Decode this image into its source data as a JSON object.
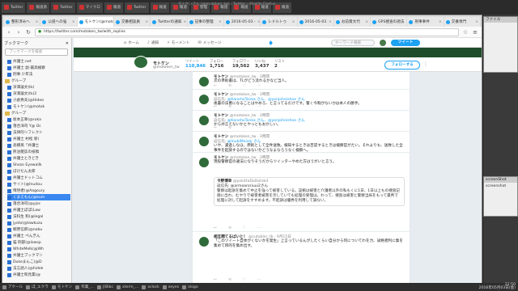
{
  "top_tabs": [
    "Twitter",
    "報道系",
    "Twitter",
    "マイクロ",
    "報道",
    "Twitter",
    "報道",
    "報道",
    "管理",
    "報道",
    "報道",
    "報道",
    "報道"
  ],
  "window_title": "モトケンさん (@motoken_tw) / Twitter – Mozilla Firefox",
  "browser_tabs": [
    {
      "label": "整形済みへ",
      "active": false
    },
    {
      "label": "公道への強",
      "active": false
    },
    {
      "label": "モトケン(@motoken",
      "active": true
    },
    {
      "label": "交番相談員",
      "active": false
    },
    {
      "label": "Twitterの通知",
      "active": false
    },
    {
      "label": "記事の整理",
      "active": false
    },
    {
      "label": "2016-05-03 -",
      "active": false
    },
    {
      "label": "レドルトゥ",
      "active": false
    },
    {
      "label": "2016-05-03",
      "active": false
    },
    {
      "label": "お前資文代",
      "active": false
    },
    {
      "label": "GPS捜査の適法",
      "active": false
    },
    {
      "label": "刑事事件",
      "active": false
    },
    {
      "label": "交番専門",
      "active": false
    }
  ],
  "url": "https://twitter.com/motoken_tw/with_replies",
  "sidebar": {
    "title": "ブックマーク",
    "search_placeholder": "ブックマークを検索",
    "items": [
      {
        "label": "弁護士.net",
        "type": "item"
      },
      {
        "label": "弁護士 副-最高検察",
        "type": "item"
      },
      {
        "label": "刑事 少年法",
        "type": "item"
      },
      {
        "label": "グループ",
        "type": "folder"
      },
      {
        "label": "深澤論文(tk)",
        "type": "item"
      },
      {
        "label": "深澤論文(tk)2",
        "type": "item"
      },
      {
        "label": "小倉秀夫(@Hideo",
        "type": "item"
      },
      {
        "label": "モトケン(@motok",
        "type": "item"
      },
      {
        "label": "グループ",
        "type": "folder"
      },
      {
        "label": "坂本正幸(@ruka",
        "type": "item"
      },
      {
        "label": "落合洋司 Y@ Oc",
        "type": "item"
      },
      {
        "label": "法律的リフレクト",
        "type": "item"
      },
      {
        "label": "弁護士 村松 新(",
        "type": "item"
      },
      {
        "label": "高橋英「弁護士",
        "type": "item"
      },
      {
        "label": "民泊雑誌の投稿",
        "type": "item"
      },
      {
        "label": "弁護士ときどき",
        "type": "item"
      },
      {
        "label": "Shozo Eyewallk",
        "type": "item"
      },
      {
        "label": "ぼけだん太郎",
        "type": "item"
      },
      {
        "label": "弁護士ドットコム",
        "type": "item"
      },
      {
        "label": "サイト(@Inudou",
        "type": "item"
      },
      {
        "label": "悔悟者(@Aagoury",
        "type": "item"
      },
      {
        "label": "くまえもん(@kum",
        "type": "item",
        "selected": true
      },
      {
        "label": "落合洋司(@yjoc",
        "type": "item"
      },
      {
        "label": "弁護士ぽぽ(Law",
        "type": "item"
      },
      {
        "label": "法科生 和(@legal",
        "type": "item"
      },
      {
        "label": "jyoto(@lawkuzu",
        "type": "item"
      },
      {
        "label": "郷原信郎(@nobu",
        "type": "item"
      },
      {
        "label": "弁護士 ぺんぎん",
        "type": "item"
      },
      {
        "label": "猫 刑部(@lawsp",
        "type": "item"
      },
      {
        "label": "WhiteMelk(@Wh",
        "type": "item"
      },
      {
        "label": "弁護士ブックマン",
        "type": "item"
      },
      {
        "label": "Dukeまんこ(@D",
        "type": "item"
      },
      {
        "label": "法言語人(@hidek",
        "type": "item"
      },
      {
        "label": "弁護士和見薫(@",
        "type": "item"
      }
    ]
  },
  "twitter": {
    "nav": [
      "ホーム",
      "通知",
      "モーメント",
      "メッセージ"
    ],
    "search_placeholder": "キーワード検索",
    "tweet_button": "ツイート",
    "profile_name": "モトケン",
    "profile_handle": "@motoken_tw",
    "stats": [
      {
        "label": "ツイート",
        "value": "110,846",
        "active": true
      },
      {
        "label": "フォロー",
        "value": "1,716"
      },
      {
        "label": "フォロワー",
        "value": "19,562"
      },
      {
        "label": "いいね",
        "value": "3,437"
      },
      {
        "label": "リスト",
        "value": "2"
      }
    ],
    "follow_button": "フォローする",
    "tweets": [
      {
        "name": "モトケン",
        "handle": "@motoken_tw · 3時間",
        "reply_to": "",
        "reply_names": "",
        "text": "次の準則書は、TLがどう流れるかなど当人。"
      },
      {
        "name": "モトケン",
        "handle": "@motoken_tw · 3時間",
        "reply_to": "返信先: ",
        "reply_names": "@KanehoTonka さん、@yonjoheishoe さん",
        "text": "後輩の法曹になることはやめろ、と言ってるだけです。警く今暇がないかは本人の勝手。"
      },
      {
        "name": "モトケン",
        "handle": "@motoken_tw · 3時間",
        "reply_to": "返信先: ",
        "reply_names": "@KanehoTonka さん、@yonjoheishoe さん",
        "text": "から弁言えないかとやっともおかしい。"
      },
      {
        "name": "モトケン",
        "handle": "@motoken_tw · 3時間",
        "reply_to": "返信先: ",
        "reply_names": "@InubiMaialy さん",
        "text": "いや、濾過しなほ、原則として全件送致。検知するときは否認するときは検察官がたい。それよりも、送致した全事件を起訴するのではないかどうなよなろうなく検察へ。"
      },
      {
        "name": "モトケン",
        "handle": "@motoken_tw · 3時間",
        "reply_to": "",
        "reply_names": "",
        "text": "現役警察官の違法になりそうだからツイッターやめた方はうがいと言う。",
        "quote_name": "卡野博幸",
        "quote_handle": "@yokittaDoDoInbd",
        "quote_reply": "返信先: @armoaroriuui2さん",
        "quote_text": "警察は起訴を集めて中止を強って被害している。証拠は被害と介護者以外の私もくに1日、1日以上もの捜査記録に出れ、むやりで被害者被害を示していても処理の受理は。わって、捜査は被害と警察当局をもって最判で処理に対して起訴をすすめます。不起訴は優秀を利用して調ない。"
      },
      {
        "name": "相互関てるばいと！",
        "handle": "@cutabler_tb · 9月15日",
        "reply_to": "",
        "reply_names": "",
        "text": "「このツイート自体がくないかを発生」上言っているんがしたくらい自分から何についてわを力、試格者利に集を集めて目的を集め出す。"
      }
    ]
  },
  "rightpanel": {
    "win1_title": "ファイル",
    "win2_title": "screenShot",
    "win2_label": "screenshot"
  },
  "taskbar": {
    "items": [
      "アクール",
      "ぼ_エクラ",
      "モトケン",
      "作業_...",
      "J(Bibc",
      "xterm_...",
      "xclock",
      "xeyes",
      "xlogo"
    ],
    "clock_time": "22:50",
    "clock_date": "2016年05月03日(金)"
  }
}
